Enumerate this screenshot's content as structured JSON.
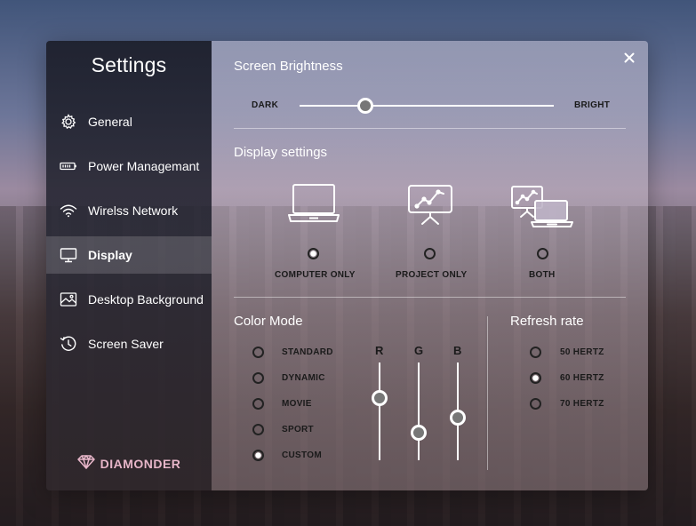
{
  "sidebar": {
    "title": "Settings",
    "items": [
      {
        "label": "General",
        "icon": "gear-icon",
        "active": false
      },
      {
        "label": "Power Managemant",
        "icon": "battery-icon",
        "active": false
      },
      {
        "label": "Wirelss Network",
        "icon": "wifi-icon",
        "active": false
      },
      {
        "label": "Display",
        "icon": "monitor-icon",
        "active": true
      },
      {
        "label": "Desktop Background",
        "icon": "image-icon",
        "active": false
      },
      {
        "label": "Screen Saver",
        "icon": "clock-icon",
        "active": false
      }
    ],
    "brand": "DIAMONDER",
    "brand_color": "#e7b6c9"
  },
  "brightness": {
    "title": "Screen Brightness",
    "dark_label": "DARK",
    "bright_label": "BRIGHT",
    "level": 0.26
  },
  "display_settings": {
    "title": "Display settings",
    "options": [
      {
        "label": "COMPUTER ONLY",
        "icon": "laptop-icon",
        "selected": true
      },
      {
        "label": "PROJECT ONLY",
        "icon": "projector-icon",
        "selected": false
      },
      {
        "label": "BOTH",
        "icon": "laptop-projector-icon",
        "selected": false
      }
    ]
  },
  "color_mode": {
    "title": "Color Mode",
    "options": [
      {
        "label": "STANDARD",
        "selected": false
      },
      {
        "label": "DYNAMIC",
        "selected": false
      },
      {
        "label": "MOVIE",
        "selected": false
      },
      {
        "label": "SPORT",
        "selected": false
      },
      {
        "label": "CUSTOM",
        "selected": true
      }
    ],
    "channels": [
      {
        "label": "R",
        "level": 0.64
      },
      {
        "label": "G",
        "level": 0.28
      },
      {
        "label": "B",
        "level": 0.44
      }
    ]
  },
  "refresh_rate": {
    "title": "Refresh rate",
    "options": [
      {
        "label": "50 HERTZ",
        "selected": false
      },
      {
        "label": "60 HERTZ",
        "selected": true
      },
      {
        "label": "70 HERTZ",
        "selected": false
      }
    ]
  }
}
